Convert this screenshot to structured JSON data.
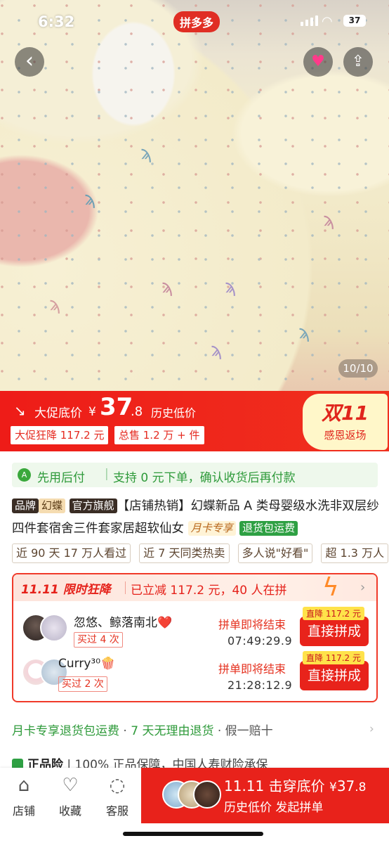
{
  "status_bar": {
    "time": "6:32",
    "app_badge": "拼多多",
    "battery": "37"
  },
  "gallery": {
    "counter": "10/10"
  },
  "price_bar": {
    "label": "大促底价",
    "currency": "¥",
    "price_int": "37",
    "price_dec": ".8",
    "low_label": "历史低价",
    "tag1": "大促狂降 117.2 元",
    "tag2": "总售 1.2 万 + 件"
  },
  "promo_badge": {
    "title": "双11",
    "subtitle": "感恩返场"
  },
  "pay_later": {
    "icon": "A",
    "title": "先用后付",
    "sep": "|",
    "desc": "支持 0 元下单，确认收货后再付款"
  },
  "product": {
    "brand_chip": "品牌",
    "brand_name": "幻蝶",
    "store_chip": "官方旗舰",
    "title_text": "【店铺热销】幻蝶新品 A 类母婴级水洗非双层纱四件套宿舍三件套家居超软仙女",
    "month_card": "月卡专享",
    "return_chip": "退货包运费"
  },
  "tags": [
    "近 90 天 17 万人看过",
    "近 7 天同类热卖",
    "多人说\"好看\"",
    "超 1.3 万人"
  ],
  "flash": {
    "title": "11.11 限时狂降",
    "subtitle": "已立减 117.2 元，40 人在拼",
    "rows": [
      {
        "name": "忽悠、鲸落南北❤️",
        "bought": "买过 4 次",
        "ending": "拼单即将结束",
        "timer": "07:49:29.9",
        "drop": "直降 117.2 元",
        "button": "直接拼成"
      },
      {
        "name": "Curry³⁰🍿",
        "bought": "买过 2 次",
        "ending": "拼单即将结束",
        "timer": "21:28:12.9",
        "drop": "直降 117.2 元",
        "button": "直接拼成"
      }
    ]
  },
  "service": {
    "a": "月卡专享退货包运费",
    "dot1": " · ",
    "b": "7 天无理由退货",
    "dot2": " · ",
    "c": "假一赔十"
  },
  "insurance": {
    "label": "正品险",
    "sep": " | ",
    "text": "100% 正品保障，中国人寿财险承保"
  },
  "bottom_bar": {
    "store": "店铺",
    "fav": "收藏",
    "service": "客服",
    "buy_title": "11.11 击穿底价 ",
    "buy_currency": "¥",
    "buy_price": "37",
    "buy_dec": ".8",
    "buy_sub": "历史低价 发起拼单"
  }
}
